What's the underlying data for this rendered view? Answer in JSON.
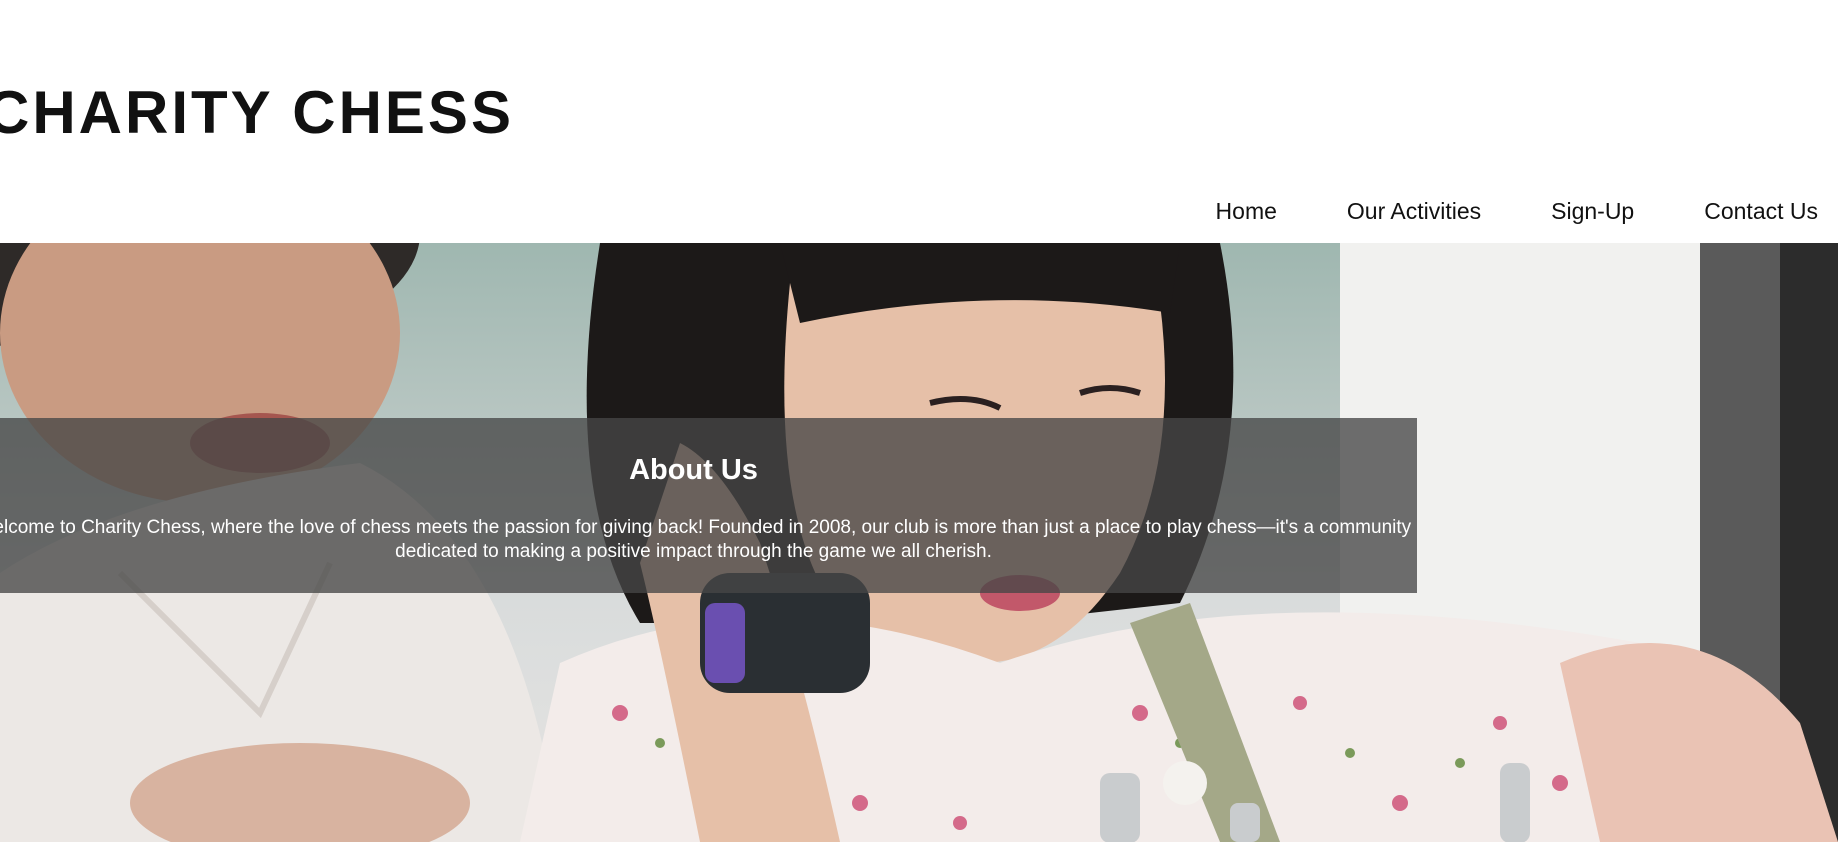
{
  "header": {
    "site_title": "CHARITY CHESS"
  },
  "nav": {
    "items": [
      {
        "label": "Home"
      },
      {
        "label": "Our Activities"
      },
      {
        "label": "Sign-Up"
      },
      {
        "label": "Contact Us"
      }
    ]
  },
  "hero": {
    "about_title": "About Us",
    "about_text": "Welcome to Charity Chess, where the love of chess meets the passion for giving back! Founded in 2008, our club is more than just a place to play chess—it's a community dedicated to making a positive impact through the game we all cherish."
  },
  "colors": {
    "text_dark": "#111111",
    "panel_overlay": "rgba(70,70,70,0.78)",
    "text_light": "#ffffff"
  }
}
